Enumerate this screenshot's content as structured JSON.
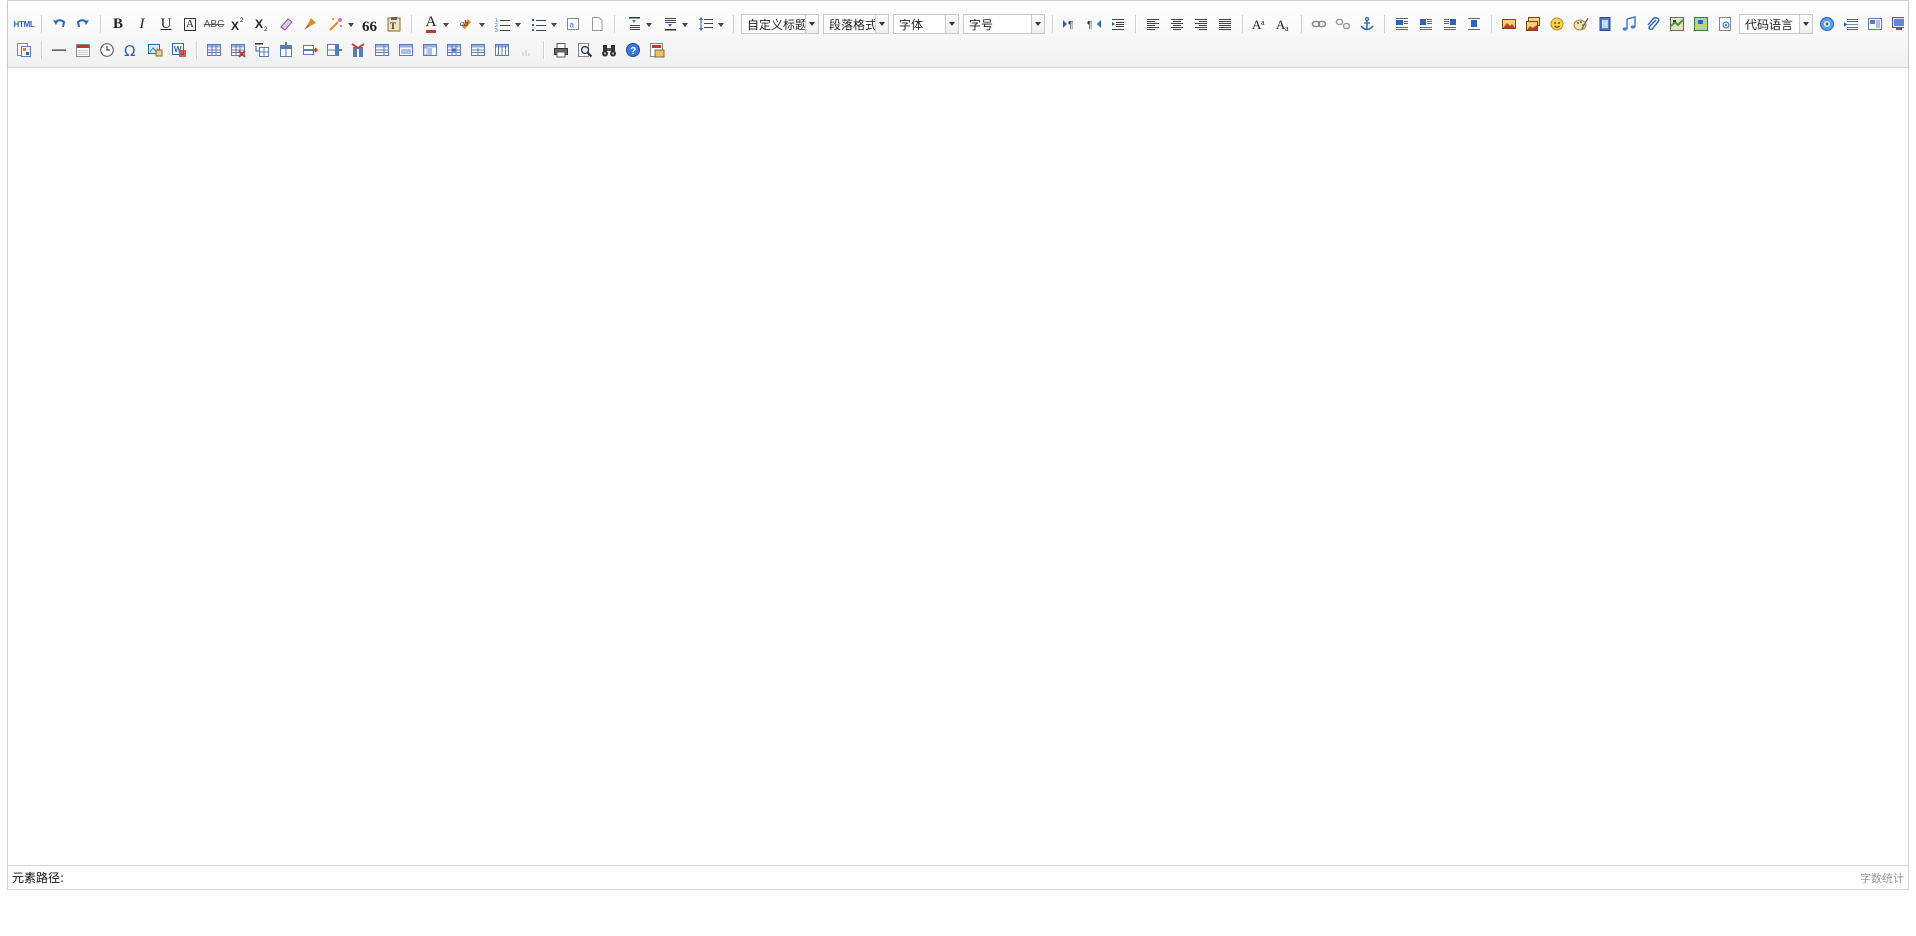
{
  "toolbar": {
    "row1": [
      {
        "type": "btn",
        "name": "source-html-button",
        "icon": "html-icon",
        "text": "HTML"
      },
      {
        "type": "sep"
      },
      {
        "type": "btn",
        "name": "undo-button",
        "icon": "undo-icon"
      },
      {
        "type": "btn",
        "name": "redo-button",
        "icon": "redo-icon"
      },
      {
        "type": "sep"
      },
      {
        "type": "btn",
        "name": "bold-button",
        "icon": "bold-icon",
        "text": "B"
      },
      {
        "type": "btn",
        "name": "italic-button",
        "icon": "italic-icon",
        "text": "I"
      },
      {
        "type": "btn",
        "name": "underline-button",
        "icon": "underline-icon",
        "text": "U"
      },
      {
        "type": "btn",
        "name": "fontborder-button",
        "icon": "font-border-icon",
        "text": "A"
      },
      {
        "type": "btn",
        "name": "strikethrough-button",
        "icon": "strikethrough-icon",
        "text": "ABC"
      },
      {
        "type": "btn",
        "name": "superscript-button",
        "icon": "superscript-icon"
      },
      {
        "type": "btn",
        "name": "subscript-button",
        "icon": "subscript-icon"
      },
      {
        "type": "btn",
        "name": "remove-format-button",
        "icon": "eraser-icon"
      },
      {
        "type": "btn",
        "name": "format-match-button",
        "icon": "brush-icon"
      },
      {
        "type": "split",
        "name": "autotypeset-button",
        "icon": "magic-wand-icon"
      },
      {
        "type": "btn",
        "name": "blockquote-button",
        "icon": "quote-icon"
      },
      {
        "type": "btn",
        "name": "paste-plain-button",
        "icon": "paste-icon"
      },
      {
        "type": "sep"
      },
      {
        "type": "split",
        "name": "forecolor-button",
        "icon": "font-color-icon",
        "text": "A"
      },
      {
        "type": "split",
        "name": "backcolor-button",
        "icon": "highlight-icon"
      },
      {
        "type": "split",
        "name": "ordered-list-button",
        "icon": "ordered-list-icon"
      },
      {
        "type": "split",
        "name": "unordered-list-button",
        "icon": "unordered-list-icon"
      },
      {
        "type": "btn",
        "name": "select-all-button",
        "icon": "select-all-icon"
      },
      {
        "type": "btn",
        "name": "clear-doc-button",
        "icon": "clear-doc-icon"
      },
      {
        "type": "sep"
      },
      {
        "type": "split",
        "name": "row-spacing-top-button",
        "icon": "row-spacing-top-icon"
      },
      {
        "type": "split",
        "name": "row-spacing-bottom-button",
        "icon": "row-spacing-bottom-icon"
      },
      {
        "type": "split",
        "name": "line-height-button",
        "icon": "line-height-icon"
      },
      {
        "type": "sep"
      },
      {
        "type": "combo",
        "name": "custom-style-select",
        "bind": "combos.customstyle",
        "width": 78
      },
      {
        "type": "combo",
        "name": "paragraph-select",
        "bind": "combos.paragraph",
        "width": 66
      },
      {
        "type": "combo",
        "name": "font-family-select",
        "bind": "combos.fontfamily",
        "width": 66
      },
      {
        "type": "combo",
        "name": "font-size-select",
        "bind": "combos.fontsize",
        "width": 82
      },
      {
        "type": "sep"
      },
      {
        "type": "btn",
        "name": "ltr-button",
        "icon": "ltr-icon"
      },
      {
        "type": "btn",
        "name": "rtl-button",
        "icon": "rtl-icon"
      },
      {
        "type": "btn",
        "name": "indent-button",
        "icon": "indent-icon"
      },
      {
        "type": "sep"
      },
      {
        "type": "btn",
        "name": "justify-left-button",
        "icon": "align-left-icon"
      },
      {
        "type": "btn",
        "name": "justify-center-button",
        "icon": "align-center-icon"
      },
      {
        "type": "btn",
        "name": "justify-right-button",
        "icon": "align-right-icon"
      },
      {
        "type": "btn",
        "name": "justify-full-button",
        "icon": "align-justify-icon"
      },
      {
        "type": "sep"
      },
      {
        "type": "btn",
        "name": "touppercase-button",
        "icon": "uppercase-icon"
      },
      {
        "type": "btn",
        "name": "tolowercase-button",
        "icon": "lowercase-icon"
      },
      {
        "type": "sep"
      },
      {
        "type": "btn",
        "name": "link-button",
        "icon": "link-icon"
      },
      {
        "type": "btn",
        "name": "unlink-button",
        "icon": "unlink-icon"
      },
      {
        "type": "btn",
        "name": "anchor-button",
        "icon": "anchor-icon"
      },
      {
        "type": "sep"
      },
      {
        "type": "btn",
        "name": "image-none-button",
        "icon": "image-none-icon"
      },
      {
        "type": "btn",
        "name": "image-left-button",
        "icon": "image-left-icon"
      },
      {
        "type": "btn",
        "name": "image-right-button",
        "icon": "image-right-icon"
      },
      {
        "type": "btn",
        "name": "image-center-button",
        "icon": "image-center-icon"
      },
      {
        "type": "sep"
      },
      {
        "type": "btn",
        "name": "simple-upload-button",
        "icon": "picture-icon"
      },
      {
        "type": "btn",
        "name": "insert-image-button",
        "icon": "images-icon"
      },
      {
        "type": "btn",
        "name": "emotion-button",
        "icon": "smiley-icon"
      },
      {
        "type": "btn",
        "name": "scrawl-button",
        "icon": "scrawl-icon"
      },
      {
        "type": "btn",
        "name": "insert-video-button",
        "icon": "video-icon"
      },
      {
        "type": "btn",
        "name": "music-button",
        "icon": "music-icon"
      },
      {
        "type": "btn",
        "name": "attachment-button",
        "icon": "attachment-icon"
      },
      {
        "type": "btn",
        "name": "map-button",
        "icon": "map-icon"
      },
      {
        "type": "btn",
        "name": "gmap-button",
        "icon": "gmap-icon"
      },
      {
        "type": "btn",
        "name": "insert-frame-button",
        "icon": "frame-icon"
      },
      {
        "type": "combo",
        "name": "code-language-select",
        "bind": "combos.codelanguage",
        "width": 74
      },
      {
        "type": "btn",
        "name": "webapp-button",
        "icon": "webapp-icon"
      },
      {
        "type": "btn",
        "name": "pagebreak-button",
        "icon": "pagebreak-icon"
      },
      {
        "type": "btn",
        "name": "template-button",
        "icon": "template-icon"
      },
      {
        "type": "btn",
        "name": "background-button",
        "icon": "background-icon"
      }
    ],
    "row2": [
      {
        "type": "btn",
        "name": "spechars-button",
        "icon": "spechars-grid-icon"
      },
      {
        "type": "sep"
      },
      {
        "type": "btn",
        "name": "horizontal-rule-button",
        "icon": "horizontal-rule-icon"
      },
      {
        "type": "btn",
        "name": "date-button",
        "icon": "calendar-icon"
      },
      {
        "type": "btn",
        "name": "time-button",
        "icon": "clock-icon"
      },
      {
        "type": "btn",
        "name": "special-chars-button",
        "icon": "omega-icon"
      },
      {
        "type": "btn",
        "name": "snapscreen-button",
        "icon": "snapscreen-icon"
      },
      {
        "type": "btn",
        "name": "word-image-button",
        "icon": "word-image-icon"
      },
      {
        "type": "sep"
      },
      {
        "type": "btn",
        "name": "insert-table-button",
        "icon": "table-icon"
      },
      {
        "type": "btn",
        "name": "delete-table-button",
        "icon": "delete-table-icon"
      },
      {
        "type": "btn",
        "name": "insert-paragraph-before-table-button",
        "icon": "paragraph-before-table-icon"
      },
      {
        "type": "btn",
        "name": "insert-row-button",
        "icon": "insert-row-icon"
      },
      {
        "type": "btn",
        "name": "delete-row-button",
        "icon": "delete-row-icon"
      },
      {
        "type": "btn",
        "name": "insert-col-button",
        "icon": "insert-col-icon"
      },
      {
        "type": "btn",
        "name": "delete-col-button",
        "icon": "delete-col-icon"
      },
      {
        "type": "btn",
        "name": "merge-cells-button",
        "icon": "merge-cells-icon"
      },
      {
        "type": "btn",
        "name": "merge-right-button",
        "icon": "merge-right-icon"
      },
      {
        "type": "btn",
        "name": "merge-down-button",
        "icon": "merge-down-icon"
      },
      {
        "type": "btn",
        "name": "split-to-cells-button",
        "icon": "split-cells-icon"
      },
      {
        "type": "btn",
        "name": "split-to-rows-button",
        "icon": "split-rows-icon"
      },
      {
        "type": "btn",
        "name": "split-to-cols-button",
        "icon": "split-cols-icon"
      },
      {
        "type": "btn",
        "name": "chart-button",
        "icon": "chart-disabled-icon"
      },
      {
        "type": "sep"
      },
      {
        "type": "btn",
        "name": "print-button",
        "icon": "print-icon"
      },
      {
        "type": "btn",
        "name": "preview-button",
        "icon": "preview-icon"
      },
      {
        "type": "btn",
        "name": "search-replace-button",
        "icon": "binoculars-icon"
      },
      {
        "type": "btn",
        "name": "help-button",
        "icon": "help-icon"
      },
      {
        "type": "btn",
        "name": "drafts-button",
        "icon": "drafts-icon"
      }
    ]
  },
  "combos": {
    "customstyle": "自定义标题",
    "paragraph": "段落格式",
    "fontfamily": "字体",
    "fontsize": "字号",
    "codelanguage": "代码语言"
  },
  "statusbar": {
    "elementpath": "元素路径:",
    "wordcount": "字数统计"
  },
  "colors": {
    "blue": "#2a65b8",
    "red": "#c0392b",
    "orange": "#e08a1e",
    "green": "#3a9a3a",
    "gray": "#555555"
  }
}
